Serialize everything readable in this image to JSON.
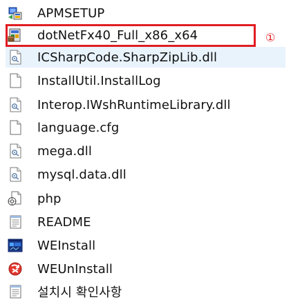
{
  "colors": {
    "highlight": "#e11b22",
    "hover_background": "#e8f3fc",
    "text": "#111111"
  },
  "annotation": {
    "marker": "①"
  },
  "files": [
    {
      "name": "APMSETUP",
      "icon": "setup-app-icon"
    },
    {
      "name": "dotNetFx40_Full_x86_x64",
      "icon": "installer-package-icon"
    },
    {
      "name": "ICSharpCode.SharpZipLib.dll",
      "icon": "dll-file-icon"
    },
    {
      "name": "InstallUtil.InstallLog",
      "icon": "blank-file-icon"
    },
    {
      "name": "Interop.IWshRuntimeLibrary.dll",
      "icon": "dll-file-icon"
    },
    {
      "name": "language.cfg",
      "icon": "blank-file-icon"
    },
    {
      "name": "mega.dll",
      "icon": "dll-file-icon"
    },
    {
      "name": "mysql.data.dll",
      "icon": "dll-file-icon"
    },
    {
      "name": "php",
      "icon": "php-script-icon"
    },
    {
      "name": "README",
      "icon": "text-document-icon"
    },
    {
      "name": "WEInstall",
      "icon": "application-window-icon"
    },
    {
      "name": "WEUnInstall",
      "icon": "uninstall-app-icon"
    },
    {
      "name": "설치시 확인사항",
      "icon": "text-document-icon"
    }
  ]
}
